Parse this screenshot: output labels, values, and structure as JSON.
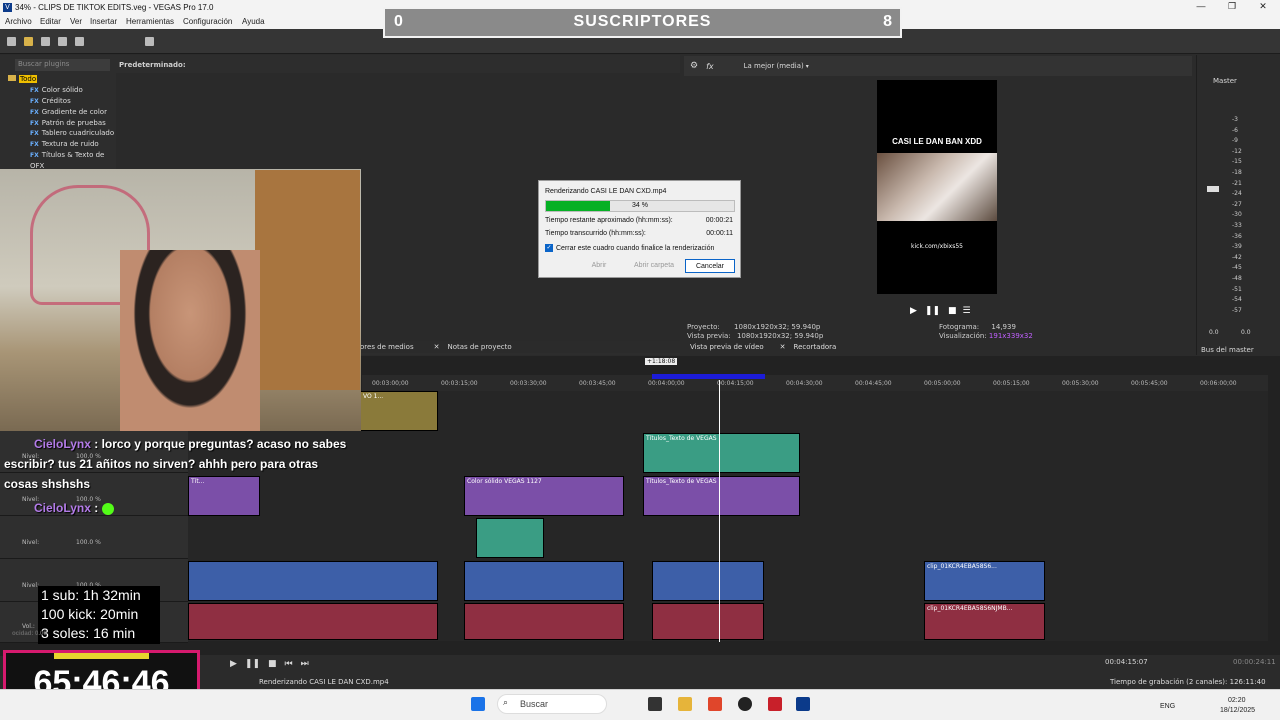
{
  "window": {
    "title": "34% - CLIPS DE TIKTOK EDITS.veg - VEGAS Pro 17.0",
    "min": "—",
    "max": "❐",
    "close": "✕"
  },
  "menu": [
    "Archivo",
    "Editar",
    "Ver",
    "Insertar",
    "Herramientas",
    "Configuración",
    "Ayuda"
  ],
  "subs": {
    "left": "0",
    "label": "SUSCRIPTORES",
    "right": "8"
  },
  "plugins": {
    "search_placeholder": "Buscar plugins",
    "preset_label": "Predeterminado:",
    "tree": [
      "Todo",
      "Color sólido",
      "Créditos",
      "Gradiente de color",
      "Patrón de pruebas",
      "Tablero cuadriculado",
      "Textura de ruido",
      "Títulos & Texto de"
    ],
    "tree_last": "OFX",
    "fx": "FX"
  },
  "preview": {
    "quality": "La mejor (media)",
    "caption": "CASI LE DAN BAN XDD",
    "url": "kick.com/xbixs55",
    "proyecto_label": "Proyecto:",
    "proyecto_val": "1080x1920x32; 59.940p",
    "vista_label": "Vista previa:",
    "vista_val": "1080x1920x32; 59.940p",
    "fotograma_label": "Fotograma:",
    "fotograma_val": "14,939",
    "visualizacion_label": "Visualización:",
    "visualizacion_val": "191x339x32",
    "tab1": "Vista previa de vídeo",
    "tab2": "Recortadora",
    "tab_medios": "ores de medios",
    "tab_notas": "Notas de proyecto"
  },
  "master": {
    "title": "Master",
    "bus": "Bus del master",
    "ticks": [
      "3",
      "6",
      "9",
      "12",
      "15",
      "18",
      "21",
      "24",
      "27",
      "30",
      "33",
      "36",
      "39",
      "42",
      "45",
      "48",
      "51",
      "54",
      "57"
    ],
    "zero_l": "0.0",
    "zero_r": "0.0"
  },
  "render": {
    "title": "Renderizando CASI LE DAN CXD.mp4",
    "percent": "34 %",
    "progress": 0.34,
    "remaining_label": "Tiempo restante aproximado (hh:mm:ss):",
    "remaining": "00:00:21",
    "elapsed_label": "Tiempo transcurrido (hh:mm:ss):",
    "elapsed": "00:00:11",
    "close_check": "Cerrar este cuadro cuando finalice la renderización",
    "btn_open": "Abrir",
    "btn_folder": "Abrir carpeta",
    "btn_cancel": "Cancelar"
  },
  "timeline": {
    "ruler": [
      "00:03:00;00",
      "00:03:15;00",
      "00:03:30;00",
      "00:03:45;00",
      "00:04:00;00",
      "00:04:15;00",
      "00:04:30;00",
      "00:04:45;00",
      "00:05:00;00",
      "00:05:15;00",
      "00:05:30;00",
      "00:05:45;00",
      "00:06:00;00"
    ],
    "loop_label": "+1:18:08",
    "clips": {
      "titulos1": "Títulos_Texto de VEGAS",
      "titulos2": "Títulos_Texto de VEGAS",
      "color": "Color sólido VEGAS 1127",
      "clip1": "clip_01KCR4EBA58S6...",
      "clip2": "clip_01KCR4EBA58S6NJMB...",
      "vo": "VO 1...",
      "tit_small": "Tít..."
    },
    "nivel": "Nivel:",
    "pct": "100.0 %",
    "vol": "Vol.:",
    "time": "00:04:15:07",
    "time_end": "00:00:24:11"
  },
  "status": {
    "rendering": "Renderizando CASI LE DAN CXD.mp4",
    "record": "Tiempo de grabación (2 canales): 126:11:40"
  },
  "stream": {
    "chat1_name": "CieloLynx",
    "chat1_text": ": lorco y porque preguntas? acaso no sabes escribir? tus 21 añitos no sirven? ahhh pero para otras cosas shshshs",
    "chat2_name": "CieloLynx",
    "chat2_text": ":",
    "stats": [
      "1 sub: 1h 32min",
      "100 kick: 20min",
      "3 soles: 16 min"
    ],
    "timer": "65:46:46",
    "timer_label": "ocidad: 0.00"
  },
  "taskbar": {
    "search": "Buscar",
    "lang": "ENG",
    "time": "02:20",
    "date": "18/12/2025"
  }
}
